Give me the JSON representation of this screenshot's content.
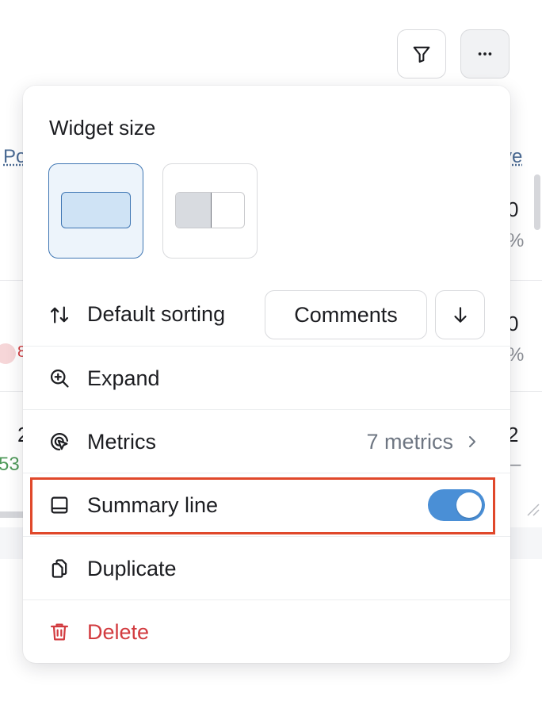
{
  "background": {
    "header_fragment_left": "Po",
    "header_fragment_right": "ve",
    "row1_value": "0",
    "row1_pct": "%",
    "row2_value": "0",
    "row2_pct": "%",
    "row3_left": "2",
    "row3_left_num": "53",
    "row3_value": "2",
    "row3_dash": "–",
    "row2_left_num": "8"
  },
  "menu": {
    "title": "Widget size",
    "sorting": {
      "label": "Default sorting",
      "field": "Comments",
      "direction_icon": "arrow-down-icon"
    },
    "items": {
      "expand": "Expand",
      "metrics": "Metrics",
      "metrics_value": "7 metrics",
      "summary": "Summary line",
      "duplicate": "Duplicate",
      "delete": "Delete"
    },
    "summary_toggle_on": true
  },
  "colors": {
    "accent": "#4a8fd6",
    "selected_border": "#3f76b3",
    "delete_red": "#d23b3f",
    "highlight": "#e0482b"
  }
}
